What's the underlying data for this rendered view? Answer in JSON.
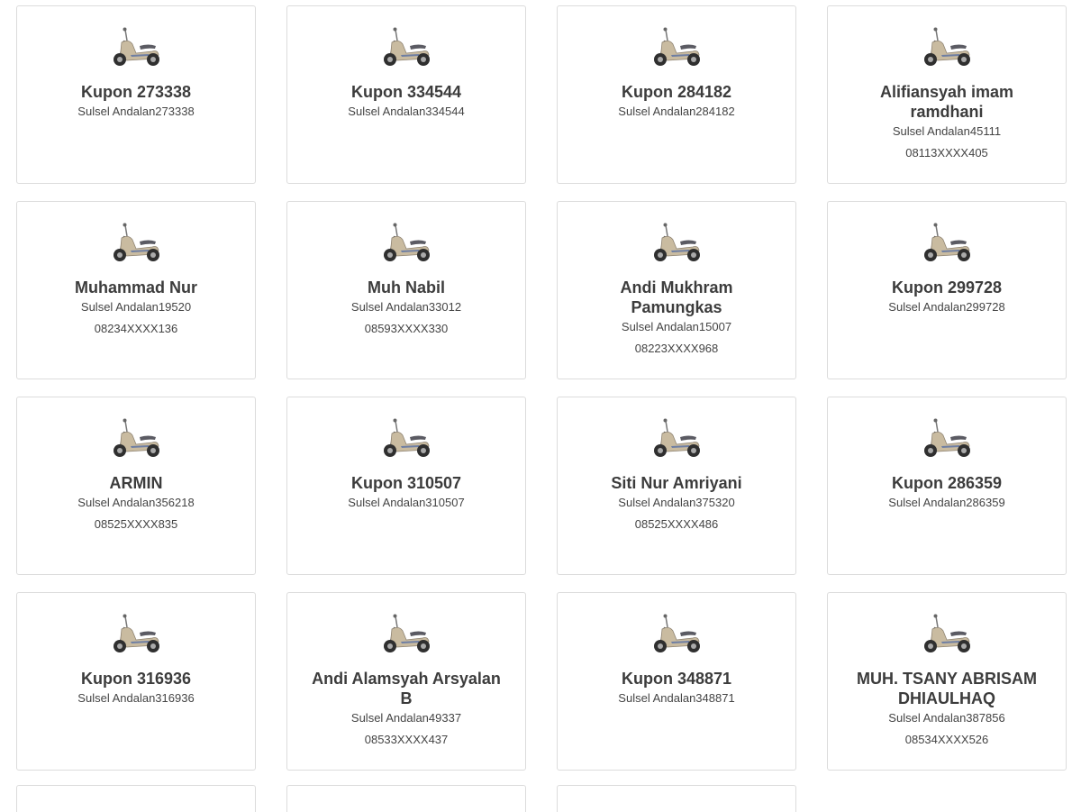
{
  "cards": [
    {
      "title": "Kupon 273338",
      "sub": "Sulsel Andalan273338",
      "phone": ""
    },
    {
      "title": "Kupon 334544",
      "sub": "Sulsel Andalan334544",
      "phone": ""
    },
    {
      "title": "Kupon 284182",
      "sub": "Sulsel Andalan284182",
      "phone": ""
    },
    {
      "title": "Alifiansyah imam ramdhani",
      "sub": "Sulsel Andalan45111",
      "phone": "08113XXXX405"
    },
    {
      "title": "Muhammad Nur",
      "sub": "Sulsel Andalan19520",
      "phone": "08234XXXX136"
    },
    {
      "title": "Muh Nabil",
      "sub": "Sulsel Andalan33012",
      "phone": "08593XXXX330"
    },
    {
      "title": "Andi Mukhram Pamungkas",
      "sub": "Sulsel Andalan15007",
      "phone": "08223XXXX968"
    },
    {
      "title": "Kupon 299728",
      "sub": "Sulsel Andalan299728",
      "phone": ""
    },
    {
      "title": "ARMIN",
      "sub": "Sulsel Andalan356218",
      "phone": "08525XXXX835"
    },
    {
      "title": "Kupon 310507",
      "sub": "Sulsel Andalan310507",
      "phone": ""
    },
    {
      "title": "Siti Nur Amriyani",
      "sub": "Sulsel Andalan375320",
      "phone": "08525XXXX486"
    },
    {
      "title": "Kupon 286359",
      "sub": "Sulsel Andalan286359",
      "phone": ""
    },
    {
      "title": "Kupon 316936",
      "sub": "Sulsel Andalan316936",
      "phone": ""
    },
    {
      "title": "Andi Alamsyah Arsyalan B",
      "sub": "Sulsel Andalan49337",
      "phone": "08533XXXX437"
    },
    {
      "title": "Kupon 348871",
      "sub": "Sulsel Andalan348871",
      "phone": ""
    },
    {
      "title": "MUH. TSANY ABRISAM DHIAULHAQ",
      "sub": "Sulsel Andalan387856",
      "phone": "08534XXXX526"
    }
  ],
  "icon": "scooter-icon",
  "colors": {
    "card_border": "#dcdcdc",
    "text": "#3c3c3c",
    "scooter_body": "#c9bba0",
    "scooter_tire": "#333333"
  }
}
